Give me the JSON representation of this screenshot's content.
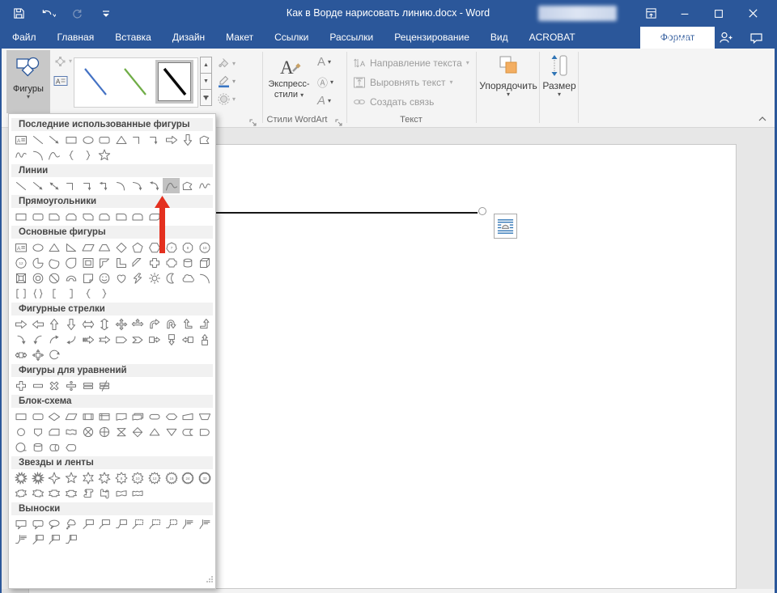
{
  "window": {
    "title": "Как в Ворде нарисовать линию.docx - Word",
    "border_color": "#2b579a"
  },
  "quick_access": {
    "buttons": [
      "save",
      "undo",
      "repeat",
      "customize-quick-access"
    ]
  },
  "window_controls": [
    "ribbon-display-options",
    "minimize",
    "maximize",
    "close"
  ],
  "tabs": {
    "items": [
      {
        "label": "Файл",
        "active": false
      },
      {
        "label": "Главная",
        "active": false
      },
      {
        "label": "Вставка",
        "active": false
      },
      {
        "label": "Дизайн",
        "active": false
      },
      {
        "label": "Макет",
        "active": false
      },
      {
        "label": "Ссылки",
        "active": false
      },
      {
        "label": "Рассылки",
        "active": false
      },
      {
        "label": "Рецензирование",
        "active": false
      },
      {
        "label": "Вид",
        "active": false
      },
      {
        "label": "ACROBAT",
        "active": false
      },
      {
        "label": "Формат",
        "active": true
      }
    ],
    "help_label": "Помощн"
  },
  "ribbon": {
    "shapes_button": {
      "label": "Фигуры"
    },
    "insert_shapes_tools": [
      "edit-shape",
      "draw-text-box"
    ],
    "style_gallery": {
      "items": [
        {
          "name": "line-style-blue",
          "color": "#4472C4",
          "selected": false
        },
        {
          "name": "line-style-green",
          "color": "#70AD47",
          "selected": false
        },
        {
          "name": "line-style-black",
          "color": "#0A0A0A",
          "selected": true
        }
      ]
    },
    "shape_tools": [
      "shape-fill",
      "shape-outline",
      "shape-effects"
    ],
    "wordart": {
      "express_label_line1": "Экспресс-",
      "express_label_line2": "стили",
      "text_tools": [
        "text-fill",
        "text-outline",
        "text-effects"
      ],
      "group_label": "Стили WordArt"
    },
    "text_group": {
      "items": [
        "Направление текста",
        "Выровнять текст",
        "Создать связь"
      ],
      "group_label": "Текст"
    },
    "arrange_group": {
      "label": "Упорядочить"
    },
    "size_group": {
      "label": "Размер"
    }
  },
  "shapes_panel": {
    "sections": [
      {
        "title": "Последние использованные фигуры",
        "rows": [
          [
            "text-box",
            "line",
            "arrow",
            "rectangle",
            "oval",
            "rounded-rectangle",
            "triangle",
            "elbow-connector",
            "elbow-arrow-connector",
            "arrow-right",
            "arrow-down",
            "freeform"
          ],
          [
            "scribble",
            "arc",
            "curve",
            "left-brace",
            "right-brace",
            "star-5"
          ]
        ]
      },
      {
        "title": "Линии",
        "rows": [
          [
            "line",
            "arrow",
            "double-arrow",
            "elbow-connector",
            "elbow-arrow-connector",
            "elbow-double-arrow-connector",
            "curved-connector",
            "curved-arrow-connector",
            "curved-double-arrow-connector",
            "curve",
            "freeform",
            "scribble"
          ]
        ],
        "highlight": {
          "row": 0,
          "index": 9,
          "shape": "curve"
        }
      },
      {
        "title": "Прямоугольники",
        "rows": [
          [
            "rectangle",
            "rounded-rectangle",
            "snip-single-corner",
            "snip-same-side-corner",
            "snip-diagonal-corner",
            "snip-round-single-corner",
            "round-single-corner",
            "round-same-side-corner",
            "round-diagonal-corner"
          ]
        ]
      },
      {
        "title": "Основные фигуры",
        "rows": [
          [
            "text-box",
            "oval",
            "triangle",
            "right-triangle",
            "parallelogram",
            "trapezoid",
            "diamond",
            "pentagon",
            "hexagon",
            "heptagon",
            "octagon",
            "decagon"
          ],
          [
            "dodecagon",
            "pie",
            "chord",
            "teardrop",
            "frame",
            "half-frame",
            "l-shape",
            "diagonal-stripe",
            "cross",
            "plaque",
            "can",
            "cube"
          ],
          [
            "bevel",
            "donut",
            "no-symbol",
            "block-arc",
            "folded-corner",
            "smiley-face",
            "heart",
            "lightning-bolt",
            "sun",
            "moon",
            "cloud",
            "arc"
          ],
          [
            "double-bracket",
            "double-brace",
            "left-bracket",
            "right-bracket",
            "left-brace",
            "right-brace"
          ]
        ]
      },
      {
        "title": "Фигурные стрелки",
        "rows": [
          [
            "arrow-right",
            "arrow-left",
            "arrow-up",
            "arrow-down",
            "arrow-left-right",
            "arrow-up-down",
            "quad-arrow",
            "left-right-up-arrow",
            "bent-arrow",
            "u-turn-arrow",
            "left-up-arrow",
            "bent-up-arrow"
          ],
          [
            "curved-right-arrow",
            "curved-left-arrow",
            "curved-up-arrow",
            "curved-down-arrow",
            "striped-right-arrow",
            "notched-right-arrow",
            "pentagon-arrow",
            "chevron-arrow",
            "right-arrow-callout",
            "down-arrow-callout",
            "left-arrow-callout",
            "up-arrow-callout"
          ],
          [
            "left-right-arrow-callout",
            "quad-arrow-callout",
            "circular-arrow"
          ]
        ]
      },
      {
        "title": "Фигуры для уравнений",
        "rows": [
          [
            "plus",
            "minus",
            "multiplication",
            "division",
            "equal",
            "not-equal"
          ]
        ]
      },
      {
        "title": "Блок-схема",
        "rows": [
          [
            "process",
            "alternate-process",
            "decision",
            "data",
            "predefined-process",
            "internal-storage",
            "document",
            "multidocument",
            "terminator",
            "preparation",
            "manual-input",
            "manual-operation"
          ],
          [
            "connector",
            "off-page-connector",
            "card",
            "punched-tape",
            "summing-junction",
            "or",
            "collate",
            "sort",
            "extract",
            "merge",
            "stored-data",
            "delay"
          ],
          [
            "sequential-access-storage",
            "magnetic-disk",
            "direct-access-storage",
            "display"
          ]
        ]
      },
      {
        "title": "Звезды и ленты",
        "rows": [
          [
            "explosion-1",
            "explosion-2",
            "star-4",
            "star-5",
            "star-6",
            "star-7",
            "star-8",
            "star-10",
            "star-12",
            "star-16",
            "star-24",
            "star-32"
          ],
          [
            "ribbon-tilted-up",
            "ribbon-tilted-down",
            "ribbon-curved-up",
            "ribbon-curved-down",
            "vertical-scroll",
            "horizontal-scroll",
            "wave",
            "double-wave"
          ]
        ]
      },
      {
        "title": "Выноски",
        "rows": [
          [
            "rectangular-callout",
            "rounded-rectangular-callout",
            "oval-callout",
            "cloud-callout",
            "line-callout-1",
            "line-callout-2",
            "line-callout-3",
            "line-callout-1-no-border",
            "line-callout-2-no-border",
            "line-callout-3-no-border",
            "line-callout-1-accent-bar",
            "line-callout-2-accent-bar"
          ],
          [
            "line-callout-3-accent-bar",
            "line-callout-1-border-accent",
            "line-callout-2-border-accent",
            "line-callout-3-border-accent"
          ]
        ]
      }
    ]
  },
  "document": {
    "drawn_shape": "straight-line",
    "selection_handle": "endpoint-handle",
    "layout_options_button": "layout-options"
  },
  "annotation": {
    "arrow_color": "#E4301F",
    "target_shape": "curve"
  }
}
